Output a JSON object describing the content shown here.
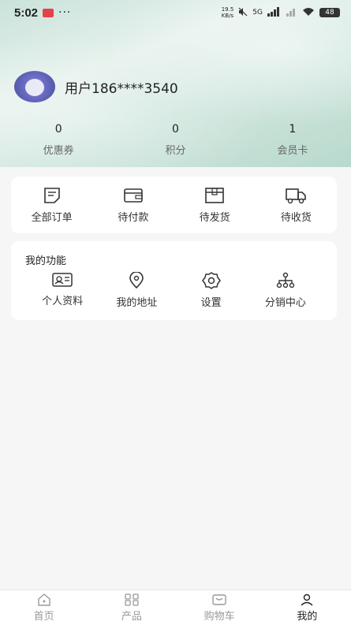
{
  "status_bar": {
    "time": "5:02",
    "network_speed": "19.5",
    "network_unit": "KB/s",
    "signal": "5G",
    "battery": "48"
  },
  "profile": {
    "username": "用户186****3540"
  },
  "stats": [
    {
      "value": "0",
      "label": "优惠券"
    },
    {
      "value": "0",
      "label": "积分"
    },
    {
      "value": "1",
      "label": "会员卡"
    }
  ],
  "orders": [
    {
      "label": "全部订单",
      "icon": "order-list-icon"
    },
    {
      "label": "待付款",
      "icon": "wallet-icon"
    },
    {
      "label": "待发货",
      "icon": "package-icon"
    },
    {
      "label": "待收货",
      "icon": "truck-icon"
    }
  ],
  "functions": {
    "title": "我的功能",
    "items": [
      {
        "label": "个人资料",
        "icon": "id-card-icon"
      },
      {
        "label": "我的地址",
        "icon": "location-pin-icon"
      },
      {
        "label": "设置",
        "icon": "gear-icon"
      },
      {
        "label": "分销中心",
        "icon": "network-icon"
      }
    ]
  },
  "tabbar": [
    {
      "label": "首页",
      "icon": "home-icon"
    },
    {
      "label": "产品",
      "icon": "grid-icon"
    },
    {
      "label": "购物车",
      "icon": "cart-icon"
    },
    {
      "label": "我的",
      "icon": "user-icon",
      "active": true
    }
  ]
}
